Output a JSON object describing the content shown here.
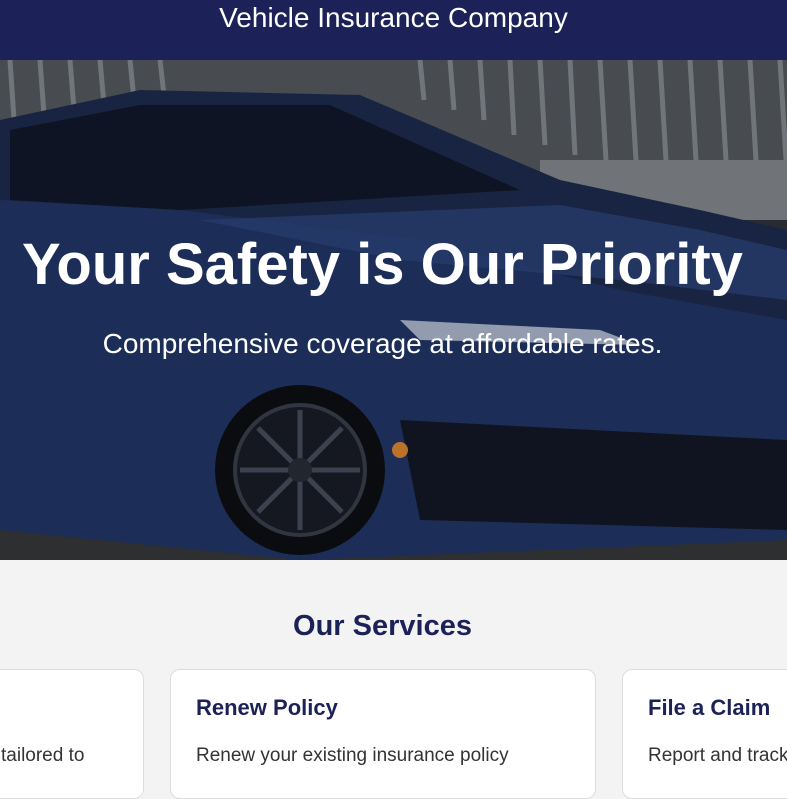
{
  "header": {
    "title": "Vehicle Insurance Company",
    "background_color": "#1c2257"
  },
  "hero": {
    "title": "Your Safety is Our Priority",
    "subtitle": "Comprehensive coverage at affordable rates.",
    "image": "blue-sports-car-photo"
  },
  "services": {
    "heading": "Our Services",
    "cards": [
      {
        "title": "",
        "description": "tailored to"
      },
      {
        "title": "Renew Policy",
        "description": "Renew your existing insurance policy"
      },
      {
        "title": "File a Claim",
        "description": "Report and track"
      }
    ]
  },
  "colors": {
    "accent": "#1c2257",
    "page_background": "#f3f3f3",
    "card_background": "#ffffff"
  }
}
